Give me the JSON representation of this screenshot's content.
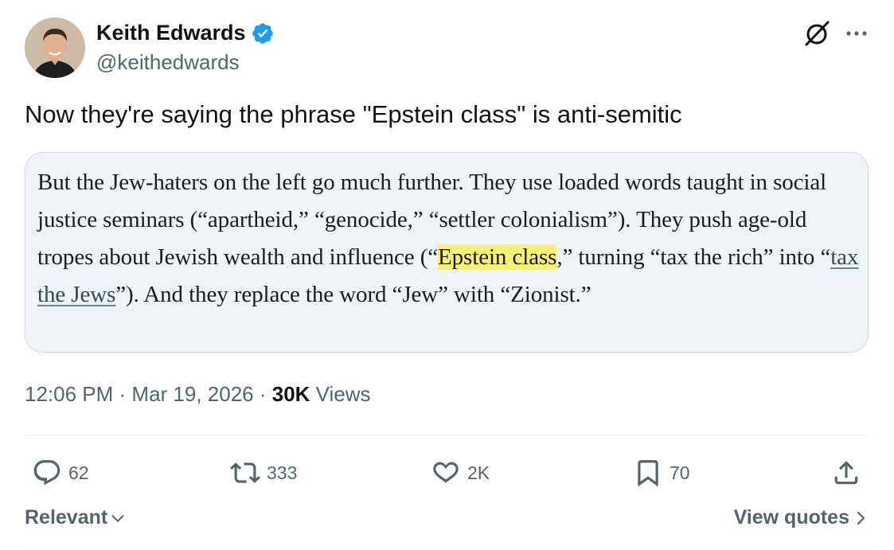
{
  "author": {
    "display_name": "Keith Edwards",
    "handle": "@keithedwards",
    "verified": true,
    "avatar_icon": "profile-photo"
  },
  "tweet": {
    "text": "Now they're saying the phrase \"Epstein class\" is anti-semitic"
  },
  "quote": {
    "part1": "But the Jew-haters on the left go much further. They use loaded words taught in social justice seminars (“apartheid,” “genocide,” “settler colonialism”). They push age-old tropes about Jewish wealth and influence (“",
    "highlight": "Epstein class",
    "part2": ",” turning “tax the rich” into “",
    "link": "tax the Jews",
    "part3": "”). And they replace the word “Jew” with “Zionist.”"
  },
  "meta": {
    "time": "12:06 PM",
    "sep1": " · ",
    "date": "Mar 19, 2026",
    "sep2": " · ",
    "views_count": "30K",
    "views_label": " Views"
  },
  "actions": {
    "replies": "62",
    "reposts": "333",
    "likes": "2K",
    "bookmarks": "70"
  },
  "footer": {
    "sort_label": "Relevant",
    "view_quotes_label": "View quotes"
  },
  "colors": {
    "verified": "#1d9bf0",
    "secondary_text": "#536471",
    "highlight": "#f8ef7a"
  }
}
